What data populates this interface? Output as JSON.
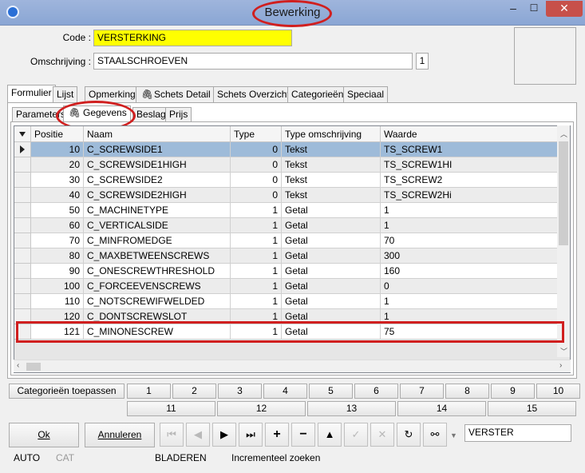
{
  "window": {
    "title": "Bewerking"
  },
  "controls": {
    "minimize": "–",
    "maximize": "☐",
    "close": "✕"
  },
  "form": {
    "code_label": "Code :",
    "code_value": "VERSTERKING",
    "omschrijving_label": "Omschrijving :",
    "omschrijving_value": "STAALSCHROEVEN",
    "omschrijving_counter": "1"
  },
  "tabs": [
    "Formulier",
    "Lijst",
    "Opmerking",
    "Schets Detail",
    "Schets Overzicht",
    "Categorieën",
    "Speciaal"
  ],
  "subtabs": [
    "Parameters",
    "Gegevens",
    "Beslag",
    "Prijs"
  ],
  "grid": {
    "columns": [
      "Positie",
      "Naam",
      "Type",
      "Type omschrijving",
      "Waarde"
    ],
    "rows": [
      [
        "10",
        "C_SCREWSIDE1",
        "0",
        "Tekst",
        "TS_SCREW1"
      ],
      [
        "20",
        "C_SCREWSIDE1HIGH",
        "0",
        "Tekst",
        "TS_SCREW1HI"
      ],
      [
        "30",
        "C_SCREWSIDE2",
        "0",
        "Tekst",
        "TS_SCREW2"
      ],
      [
        "40",
        "C_SCREWSIDE2HIGH",
        "0",
        "Tekst",
        "TS_SCREW2Hi"
      ],
      [
        "50",
        "C_MACHINETYPE",
        "1",
        "Getal",
        "1"
      ],
      [
        "60",
        "C_VERTICALSIDE",
        "1",
        "Getal",
        "1"
      ],
      [
        "70",
        "C_MINFROMEDGE",
        "1",
        "Getal",
        "70"
      ],
      [
        "80",
        "C_MAXBETWEENSCREWS",
        "1",
        "Getal",
        "300"
      ],
      [
        "90",
        "C_ONESCREWTHRESHOLD",
        "1",
        "Getal",
        "160"
      ],
      [
        "100",
        "C_FORCEEVENSCREWS",
        "1",
        "Getal",
        "0"
      ],
      [
        "110",
        "C_NOTSCREWIFWELDED",
        "1",
        "Getal",
        "1"
      ],
      [
        "120",
        "C_DONTSCREWSLOT",
        "1",
        "Getal",
        "1"
      ],
      [
        "121",
        "C_MINONESCREW",
        "1",
        "Getal",
        "75"
      ]
    ]
  },
  "categories": {
    "apply_label": "Categorieën toepassen",
    "row1": [
      "1",
      "2",
      "3",
      "4",
      "5",
      "6",
      "7",
      "8",
      "9",
      "10"
    ],
    "row2": [
      "11",
      "12",
      "13",
      "14",
      "15"
    ]
  },
  "bottom": {
    "ok_label": "Ok",
    "cancel_label": "Annuleren",
    "search_value": "VERSTER"
  },
  "status": {
    "auto": "AUTO",
    "cat": "CAT",
    "mode": "BLADEREN",
    "hint": "Incrementeel zoeken"
  },
  "colors": {
    "highlight_row": "#9ebbd9",
    "code_field_bg": "#ffff00",
    "annotation": "#d01f1f"
  }
}
